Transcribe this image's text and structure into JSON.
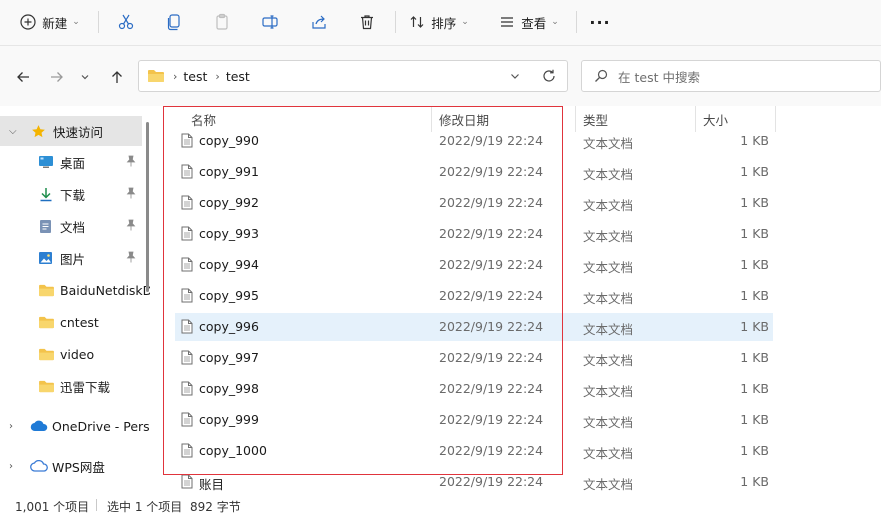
{
  "toolbar": {
    "new_label": "新建",
    "sort_label": "排序",
    "view_label": "查看",
    "more_label": "···"
  },
  "address": {
    "crumbs": [
      "test",
      "test"
    ]
  },
  "search": {
    "placeholder": "在 test 中搜索"
  },
  "sidebar": {
    "quick_access": "快速访问",
    "items": [
      {
        "label": "桌面"
      },
      {
        "label": "下载"
      },
      {
        "label": "文档"
      },
      {
        "label": "图片"
      },
      {
        "label": "BaiduNetdiskD"
      },
      {
        "label": "cntest"
      },
      {
        "label": "video"
      },
      {
        "label": "迅雷下载"
      }
    ],
    "onedrive": "OneDrive - Pers",
    "wps": "WPS网盘"
  },
  "list": {
    "headers": {
      "name": "名称",
      "date": "修改日期",
      "type": "类型",
      "size": "大小"
    },
    "rows": [
      {
        "name": "copy_990",
        "date": "2022/9/19 22:24",
        "type": "文本文档",
        "size": "1 KB"
      },
      {
        "name": "copy_991",
        "date": "2022/9/19 22:24",
        "type": "文本文档",
        "size": "1 KB"
      },
      {
        "name": "copy_992",
        "date": "2022/9/19 22:24",
        "type": "文本文档",
        "size": "1 KB"
      },
      {
        "name": "copy_993",
        "date": "2022/9/19 22:24",
        "type": "文本文档",
        "size": "1 KB"
      },
      {
        "name": "copy_994",
        "date": "2022/9/19 22:24",
        "type": "文本文档",
        "size": "1 KB"
      },
      {
        "name": "copy_995",
        "date": "2022/9/19 22:24",
        "type": "文本文档",
        "size": "1 KB"
      },
      {
        "name": "copy_996",
        "date": "2022/9/19 22:24",
        "type": "文本文档",
        "size": "1 KB"
      },
      {
        "name": "copy_997",
        "date": "2022/9/19 22:24",
        "type": "文本文档",
        "size": "1 KB"
      },
      {
        "name": "copy_998",
        "date": "2022/9/19 22:24",
        "type": "文本文档",
        "size": "1 KB"
      },
      {
        "name": "copy_999",
        "date": "2022/9/19 22:24",
        "type": "文本文档",
        "size": "1 KB"
      },
      {
        "name": "copy_1000",
        "date": "2022/9/19 22:24",
        "type": "文本文档",
        "size": "1 KB"
      },
      {
        "name": "账目",
        "date": "2022/9/19 22:24",
        "type": "文本文档",
        "size": "1 KB"
      }
    ]
  },
  "status": {
    "count": "1,001 个项目",
    "selected": "选中 1 个项目",
    "size": "892 字节"
  },
  "colors": {
    "accent": "#0067c0",
    "selection": "#e5f1fb",
    "highlight_border": "#e0343c",
    "folder": "#f3c34b"
  }
}
